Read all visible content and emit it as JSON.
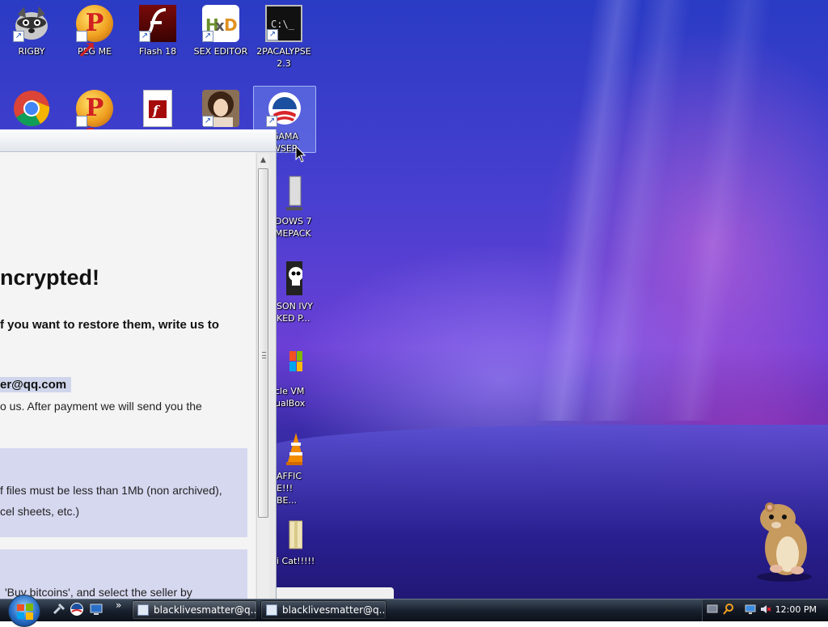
{
  "desktop_icons": {
    "rigby": "RIGBY",
    "peg_me": "PEG ME",
    "flash18": "Flash 18",
    "sex_editor": "SEX EDITOR",
    "pacalypse_l1": "2PACALYPSE",
    "pacalypse_l2": "2.3",
    "obama_l1": "GAMA",
    "obama_l2": "WSER",
    "win7_l1": "DOWS 7",
    "win7_l2": "MEPACK",
    "poison_l1": "SON IVY",
    "poison_l2": "KED P...",
    "vbox_l1": "cle VM",
    "vbox_l2": "ualBox",
    "traffic_l1": "AFFIC",
    "traffic_l2": "E!!! BE...",
    "cat": "i Cat!!!!!"
  },
  "window": {
    "heading": "ncrypted!",
    "subheading": "f you want to restore them, write us to",
    "email": "er@qq.com",
    "line_payment_1": "o us. After payment we will send you the",
    "line_files_1": "f files must be less than 1Mb (non archived),",
    "line_files_2": "cel sheets, etc.)",
    "line_bitcoin": "'Buy bitcoins', and select the seller by"
  },
  "taskbar": {
    "task1_label": "blacklivesmatter@q...",
    "task2_label": "blacklivesmatter@q...",
    "clock": "12:00 PM"
  },
  "colors": {
    "highlight_email": "#cfd6ec",
    "info_box": "#d6d8f0"
  }
}
